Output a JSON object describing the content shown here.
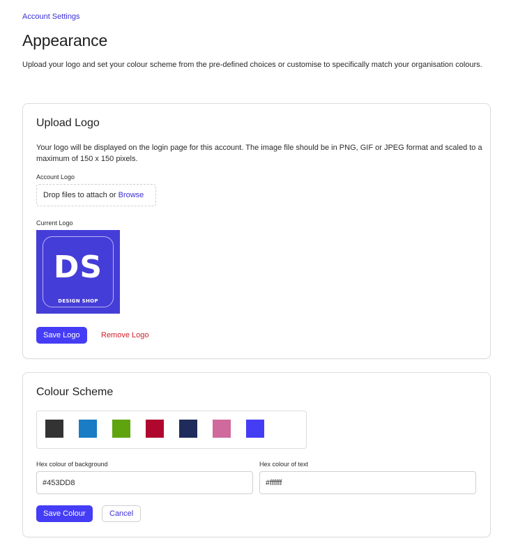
{
  "breadcrumb": "Account Settings",
  "page": {
    "title": "Appearance",
    "description": "Upload your logo and set your colour scheme from the pre-defined choices or customise to specifically match your organisation colours."
  },
  "upload_logo": {
    "title": "Upload Logo",
    "description": "Your logo will be displayed on the login page for this account. The image file should be in PNG, GIF or JPEG format and scaled to a maximum of 150 x 150 pixels.",
    "account_logo_label": "Account Logo",
    "dropzone_text": "Drop files to attach or ",
    "browse_label": "Browse",
    "current_logo_label": "Current Logo",
    "logo": {
      "initials": "DS",
      "name": "DESIGN SHOP",
      "color": "#453DD8"
    },
    "save_label": "Save Logo",
    "remove_label": "Remove Logo"
  },
  "colour_scheme": {
    "title": "Colour Scheme",
    "swatches": [
      "#333333",
      "#1A7CC4",
      "#5FA40F",
      "#B0072F",
      "#1F2B5A",
      "#D0699C",
      "#453DF5"
    ],
    "background_label": "Hex colour of background",
    "background_value": "#453DD8",
    "text_label": "Hex colour of text",
    "text_value": "#ffffff",
    "save_label": "Save Colour",
    "cancel_label": "Cancel"
  }
}
